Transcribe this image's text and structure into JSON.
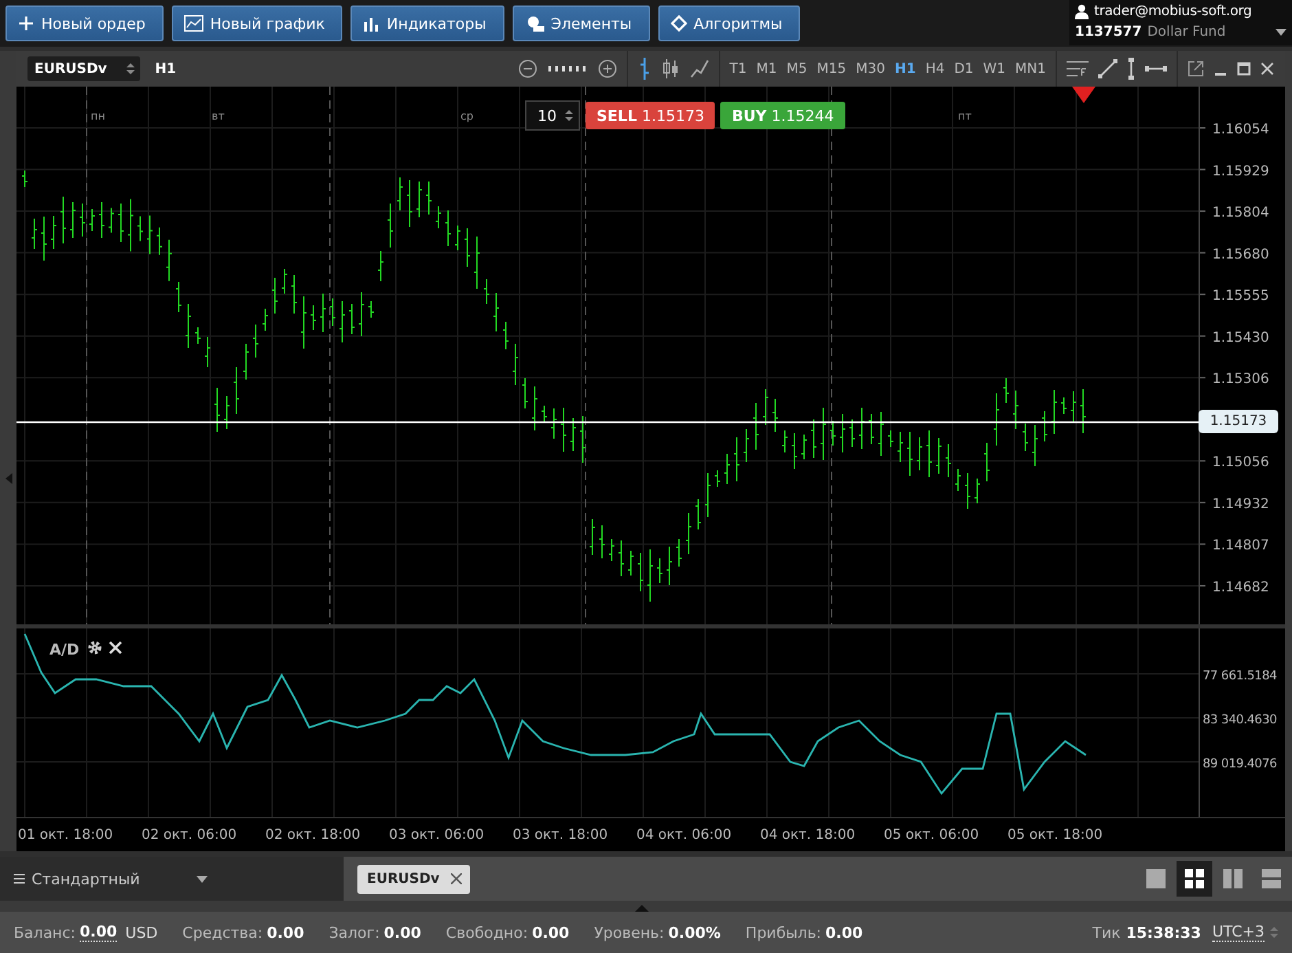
{
  "top_buttons": [
    {
      "label": "Новый ордер"
    },
    {
      "label": "Новый график"
    },
    {
      "label": "Индикаторы"
    },
    {
      "label": "Элементы"
    },
    {
      "label": "Алгоритмы"
    }
  ],
  "account": {
    "email": "trader@mobius-soft.org",
    "number": "1137577",
    "fund": "Dollar Fund"
  },
  "chart_toolbar": {
    "symbol": "EURUSDv",
    "period": "H1",
    "timeframes": [
      {
        "label": "T1",
        "selected": false
      },
      {
        "label": "M1",
        "selected": false
      },
      {
        "label": "M5",
        "selected": false
      },
      {
        "label": "M15",
        "selected": false
      },
      {
        "label": "M30",
        "selected": false
      },
      {
        "label": "H1",
        "selected": true
      },
      {
        "label": "H4",
        "selected": false
      },
      {
        "label": "D1",
        "selected": false
      },
      {
        "label": "W1",
        "selected": false
      },
      {
        "label": "MN1",
        "selected": false
      }
    ]
  },
  "order_panel": {
    "volume": "10",
    "sell": {
      "label": "SELL",
      "price": "1.15173"
    },
    "buy": {
      "label": "BUY",
      "price": "1.15244"
    }
  },
  "chart": {
    "day_labels": [
      "пн",
      "вт",
      "ср",
      "пт"
    ],
    "price_labels": [
      "1.16054",
      "1.15929",
      "1.15804",
      "1.15680",
      "1.15555",
      "1.15430",
      "1.15306",
      "1.15056",
      "1.14932",
      "1.14807",
      "1.14682"
    ],
    "current_price": "1.15173",
    "time_labels": [
      "01 окт. 18:00",
      "02 окт. 06:00",
      "02 окт. 18:00",
      "03 окт. 06:00",
      "03 окт. 18:00",
      "04 окт. 06:00",
      "04 окт. 18:00",
      "05 окт. 06:00",
      "05 окт. 18:00"
    ]
  },
  "indicator": {
    "name": "A/D",
    "labels": [
      "77 661.5184",
      "83 340.4630",
      "89 019.4076"
    ]
  },
  "workspace": {
    "name": "Стандартный",
    "tabs": [
      {
        "label": "EURUSDv",
        "selected": true
      }
    ],
    "layouts": [
      {
        "selected": false
      },
      {
        "selected": true
      },
      {
        "selected": false
      },
      {
        "selected": false
      }
    ]
  },
  "status_bar": {
    "items": [
      {
        "label": "Баланс:",
        "value": "0.00",
        "unit": "USD"
      },
      {
        "label": "Средства:",
        "value": "0.00"
      },
      {
        "label": "Залог:",
        "value": "0.00"
      },
      {
        "label": "Свободно:",
        "value": "0.00"
      },
      {
        "label": "Уровень:",
        "value": "0.00%"
      },
      {
        "label": "Прибыль:",
        "value": "0.00"
      }
    ],
    "tick_label": "Тик",
    "time": "15:38:33",
    "timezone": "UTC+3"
  }
}
